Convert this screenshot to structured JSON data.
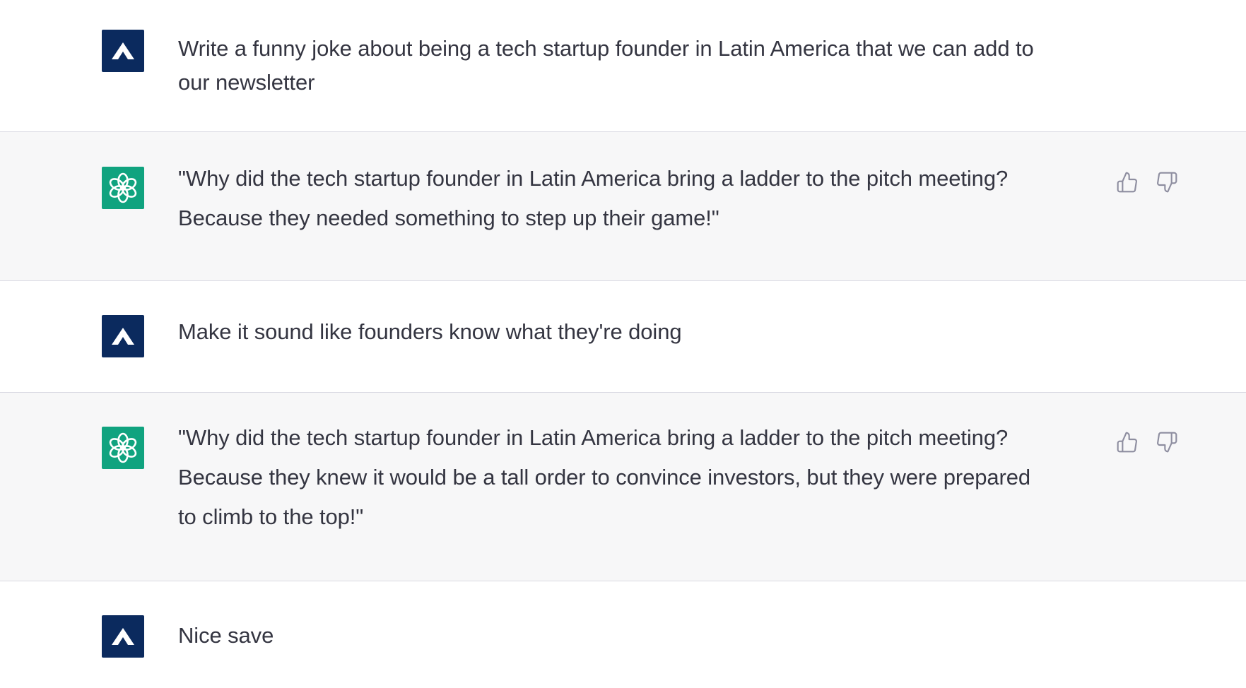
{
  "conversation": {
    "messages": [
      {
        "role": "user",
        "avatar_icon": "user-logo-icon",
        "lines": [
          "Write a funny joke about being a tech startup founder in Latin America that we can add to",
          "our newsletter"
        ]
      },
      {
        "role": "assistant",
        "avatar_icon": "openai-logo-icon",
        "lines": [
          "\"Why did the tech startup founder in Latin America bring a ladder to the pitch meeting?",
          "Because they needed something to step up their game!\""
        ],
        "feedback": [
          "thumbs-up-icon",
          "thumbs-down-icon"
        ]
      },
      {
        "role": "user",
        "avatar_icon": "user-logo-icon",
        "lines": [
          "Make it sound like founders know what they're doing"
        ]
      },
      {
        "role": "assistant",
        "avatar_icon": "openai-logo-icon",
        "lines": [
          "\"Why did the tech startup founder in Latin America bring a ladder to the pitch meeting?",
          "Because they knew it would be a tall order to convince investors, but they were prepared",
          "to climb to the top!\""
        ],
        "feedback": [
          "thumbs-up-icon",
          "thumbs-down-icon"
        ]
      },
      {
        "role": "user",
        "avatar_icon": "user-logo-icon",
        "lines": [
          "Nice save"
        ]
      }
    ]
  },
  "colors": {
    "user_avatar_bg": "#0b2a5e",
    "assistant_avatar_bg": "#10a37f",
    "assistant_row_bg": "#f7f7f8",
    "text": "#343541",
    "divider": "#d9d9e3",
    "feedback_icon": "#8e8ea0"
  }
}
